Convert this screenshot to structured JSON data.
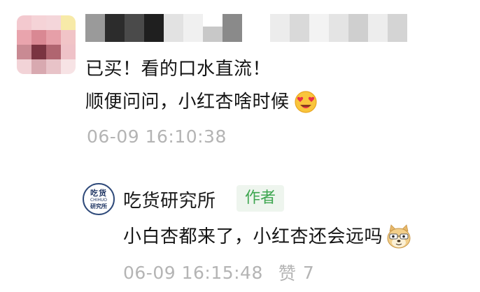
{
  "comment": {
    "line1": "已买！看的口水直流！",
    "line2": "顺便问问，小红杏啥时候",
    "emoji": "heart-eyes-emoji",
    "timestamp": "06-09 16:10:38"
  },
  "reply": {
    "avatar_text_top": "吃货",
    "avatar_text_mid": "CHIHUO",
    "avatar_text_bottom": "研究所",
    "author_name": "吃货研究所",
    "badge": "作者",
    "text": "小白杏都来了，小红杏还会远吗",
    "emoji": "doge-emoji",
    "timestamp": "06-09 16:15:48",
    "like_label": "赞",
    "like_count": "7"
  },
  "colors": {
    "badge_green": "#3ea650",
    "timestamp_gray": "#b4b4b4",
    "avatar_navy": "#1f3563"
  }
}
